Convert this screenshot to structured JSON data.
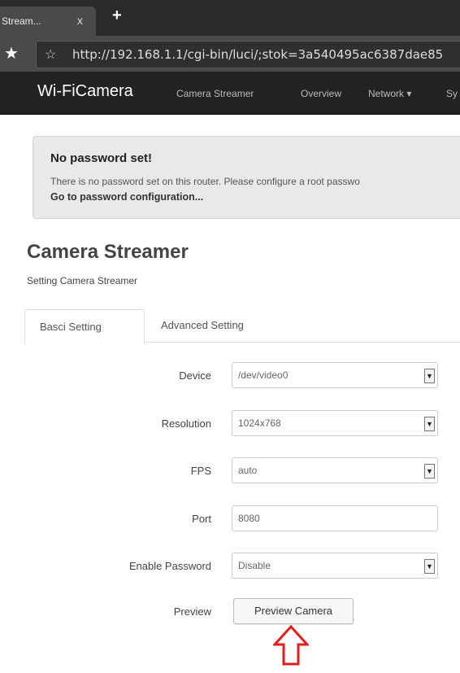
{
  "browser": {
    "tab_title": "Stream...",
    "tab_close": "x",
    "new_tab": "+",
    "url": "http://192.168.1.1/cgi-bin/luci/;stok=3a540495ac6387dae85"
  },
  "navbar": {
    "brand": "Wi-FiCamera",
    "items": [
      "Camera Streamer",
      "Overview",
      "Network ▾",
      "Sy"
    ]
  },
  "alert": {
    "title": "No password set!",
    "text": "There is no password set on this router. Please configure a root passwo",
    "link": "Go to password configuration..."
  },
  "page": {
    "title": "Camera Streamer",
    "subtitle": "Setting Camera Streamer"
  },
  "tabs": [
    "Basci Setting",
    "Advanced Setting"
  ],
  "form": {
    "device": {
      "label": "Device",
      "value": "/dev/video0"
    },
    "resolution": {
      "label": "Resolution",
      "value": "1024x768"
    },
    "fps": {
      "label": "FPS",
      "value": "auto"
    },
    "port": {
      "label": "Port",
      "value": "8080"
    },
    "enable_password": {
      "label": "Enable Password",
      "value": "Disable"
    },
    "preview": {
      "label": "Preview",
      "button": "Preview Camera"
    }
  },
  "colors": {
    "navbar_bg": "#222222",
    "alert_bg": "#e9e9e9",
    "annotation_arrow": "#e01e1e"
  },
  "icons": {
    "bookmark": "star-icon",
    "dropdown": "chevron-down-icon",
    "annotation": "up-arrow-icon"
  }
}
